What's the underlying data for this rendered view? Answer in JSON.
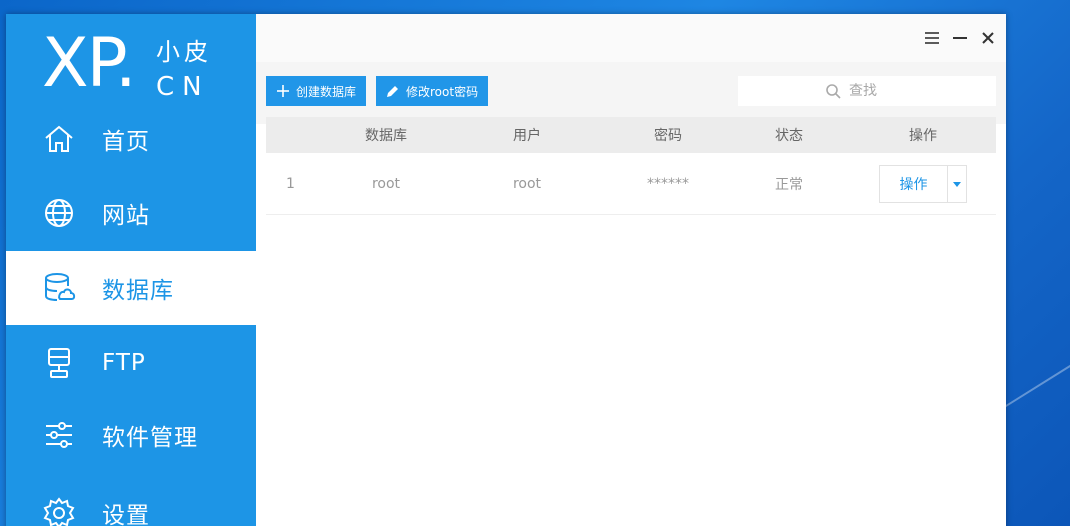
{
  "logo": {
    "brand": "XP.",
    "small_text": "小皮",
    "domain": "CN"
  },
  "sidebar": {
    "items": [
      {
        "label": "首页",
        "icon": "home-icon"
      },
      {
        "label": "网站",
        "icon": "globe-icon"
      },
      {
        "label": "数据库",
        "icon": "database-icon",
        "active": true
      },
      {
        "label": "FTP",
        "icon": "ftp-icon"
      },
      {
        "label": "软件管理",
        "icon": "sliders-icon"
      },
      {
        "label": "设置",
        "icon": "gear-icon"
      }
    ]
  },
  "window_controls": {
    "menu": "menu-icon",
    "minimize": "minimize-icon",
    "close": "close-icon"
  },
  "toolbar": {
    "create_label": "创建数据库",
    "change_pwd_label": "修改root密码"
  },
  "search": {
    "placeholder": "查找"
  },
  "table": {
    "headers": [
      "",
      "数据库",
      "用户",
      "密码",
      "状态",
      "操作"
    ],
    "rows": [
      {
        "index": "1",
        "database": "root",
        "user": "root",
        "password": "******",
        "status": "正常",
        "action": "操作"
      }
    ]
  },
  "colors": {
    "accent": "#1d95e6",
    "sidebar": "#1d95e6",
    "button": "#2196e8"
  }
}
